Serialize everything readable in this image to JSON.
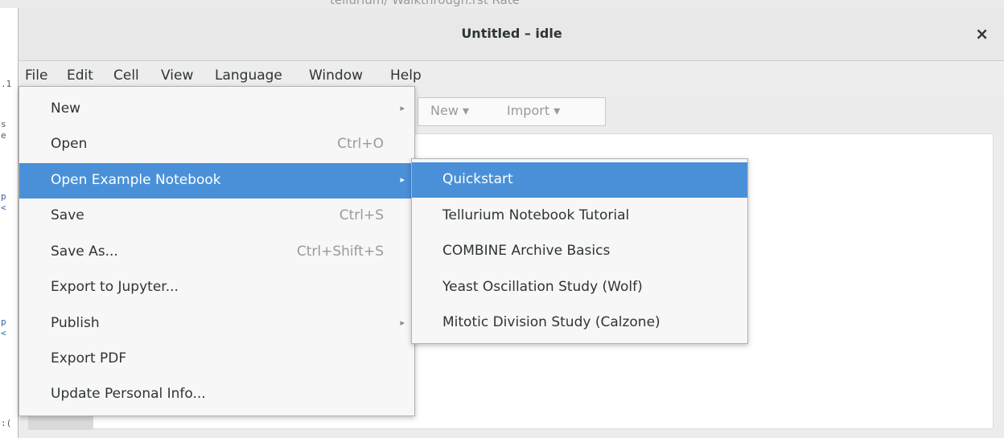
{
  "background_window": {
    "top_text": "tellurium/ Walkthrough.rst       Rate",
    "left_glyphs": [
      ".1",
      "s",
      "e",
      "p",
      "<",
      "p",
      "<",
      ":("
    ]
  },
  "window": {
    "title": "Untitled – idle",
    "close_label": "×"
  },
  "menubar": {
    "items": [
      "File",
      "Edit",
      "Cell",
      "View",
      "Language",
      "Window",
      "Help"
    ]
  },
  "toolbar": {
    "new_label": "New ▾",
    "import_label": "Import ▾"
  },
  "file_menu": {
    "items": [
      {
        "label": "New",
        "accel": "",
        "submenu": true
      },
      {
        "label": "Open",
        "accel": "Ctrl+O",
        "submenu": false
      },
      {
        "label": "Open Example Notebook",
        "accel": "",
        "submenu": true,
        "highlighted": true
      },
      {
        "label": "Save",
        "accel": "Ctrl+S",
        "submenu": false
      },
      {
        "label": "Save As...",
        "accel": "Ctrl+Shift+S",
        "submenu": false
      },
      {
        "label": "Export to Jupyter...",
        "accel": "",
        "submenu": false
      },
      {
        "label": "Publish",
        "accel": "",
        "submenu": true
      },
      {
        "label": "Export PDF",
        "accel": "",
        "submenu": false
      },
      {
        "label": "Update Personal Info...",
        "accel": "",
        "submenu": false
      }
    ]
  },
  "example_submenu": {
    "items": [
      {
        "label": "Quickstart",
        "highlighted": true
      },
      {
        "label": "Tellurium Notebook Tutorial"
      },
      {
        "label": "COMBINE Archive Basics"
      },
      {
        "label": "Yeast Oscillation Study (Wolf)"
      },
      {
        "label": "Mitotic Division Study (Calzone)"
      }
    ]
  },
  "icons": {
    "submenu_arrow": "▸"
  },
  "colors": {
    "highlight": "#4a90d9",
    "menu_bg": "#f7f7f7",
    "window_bg": "#ececec"
  }
}
